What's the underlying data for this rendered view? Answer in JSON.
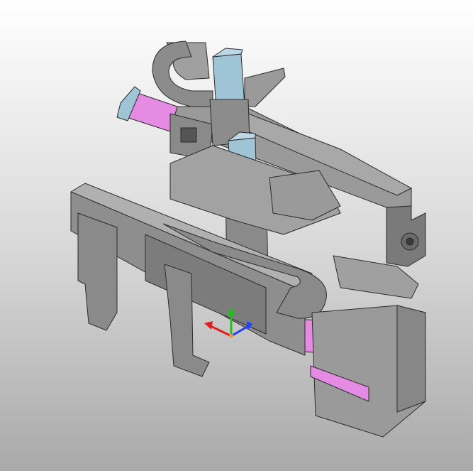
{
  "viewport": {
    "background_top": "#ffffff",
    "background_bottom": "#a9a9a9"
  },
  "model": {
    "body_color": "#8e8e8e",
    "body_dark": "#6f6f6f",
    "body_light": "#a4a4a4",
    "edge_color": "#2b2b2b",
    "motor_color": "#e68be3",
    "motor_cap": "#9fc4d6",
    "accent_blue": "#3a3aff"
  },
  "triad": {
    "x_color": "#e02020",
    "y_color": "#20c020",
    "z_color": "#2040ff",
    "origin_color": "#e0a040"
  }
}
